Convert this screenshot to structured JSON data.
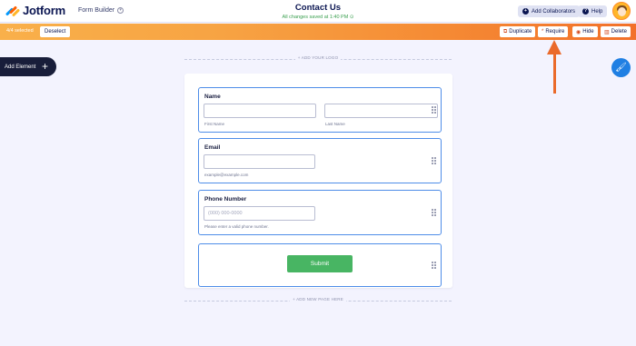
{
  "header": {
    "logo_text": "Jotform",
    "form_builder_label": "Form Builder",
    "form_title": "Contact Us",
    "saved_status": "All changes saved at 1:40 PM",
    "add_collaborators_label": "Add Collaborators",
    "help_label": "Help"
  },
  "actionbar": {
    "selected_text": "4/4 selected",
    "deselect_label": "Deselect",
    "duplicate_label": "Duplicate",
    "require_label": "Require",
    "hide_label": "Hide",
    "delete_label": "Delete"
  },
  "sidebar": {
    "add_element_label": "Add Element"
  },
  "canvas": {
    "add_logo_label": "+ ADD YOUR LOGO",
    "add_page_label": "+ ADD NEW PAGE HERE"
  },
  "form": {
    "name_field": {
      "label": "Name",
      "first_sublabel": "First Name",
      "last_sublabel": "Last Name"
    },
    "email_field": {
      "label": "Email",
      "sublabel": "example@example.com"
    },
    "phone_field": {
      "label": "Phone Number",
      "placeholder": "(000) 000-0000",
      "sublabel": "Please enter a valid phone number."
    },
    "submit_label": "Submit"
  },
  "colors": {
    "accent_orange": "#f58a34",
    "selection_blue": "#4e8de8",
    "submit_green": "#48b563",
    "annotation_arrow": "#ea6a2b"
  }
}
